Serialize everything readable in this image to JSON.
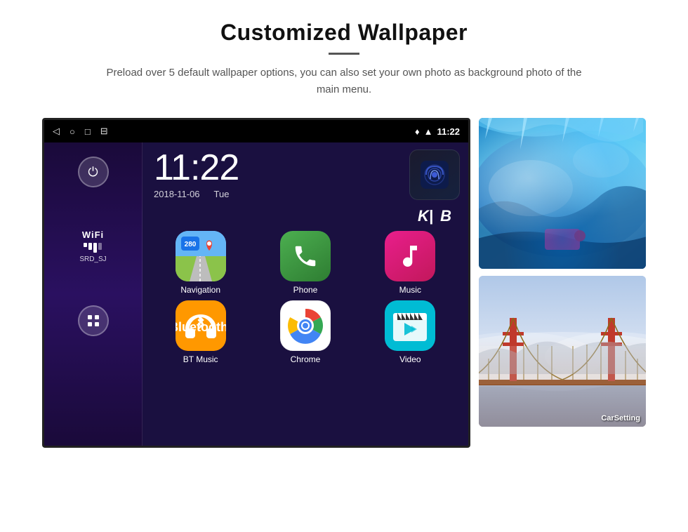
{
  "header": {
    "title": "Customized Wallpaper",
    "description": "Preload over 5 default wallpaper options, you can also set your own photo as background photo of the main menu."
  },
  "statusBar": {
    "time": "11:22",
    "navIcons": [
      "◁",
      "○",
      "□",
      "⊟"
    ]
  },
  "clockWidget": {
    "time": "11:22",
    "date": "2018-11-06",
    "day": "Tue"
  },
  "wifi": {
    "label": "WiFi",
    "ssid": "SRD_SJ"
  },
  "apps": [
    {
      "id": "navigation",
      "label": "Navigation"
    },
    {
      "id": "phone",
      "label": "Phone"
    },
    {
      "id": "music",
      "label": "Music"
    },
    {
      "id": "btmusic",
      "label": "BT Music"
    },
    {
      "id": "chrome",
      "label": "Chrome"
    },
    {
      "id": "video",
      "label": "Video"
    }
  ],
  "wallpapers": [
    {
      "id": "ice",
      "type": "ice-cave"
    },
    {
      "id": "bridge",
      "type": "bridge",
      "label": "CarSetting"
    }
  ]
}
